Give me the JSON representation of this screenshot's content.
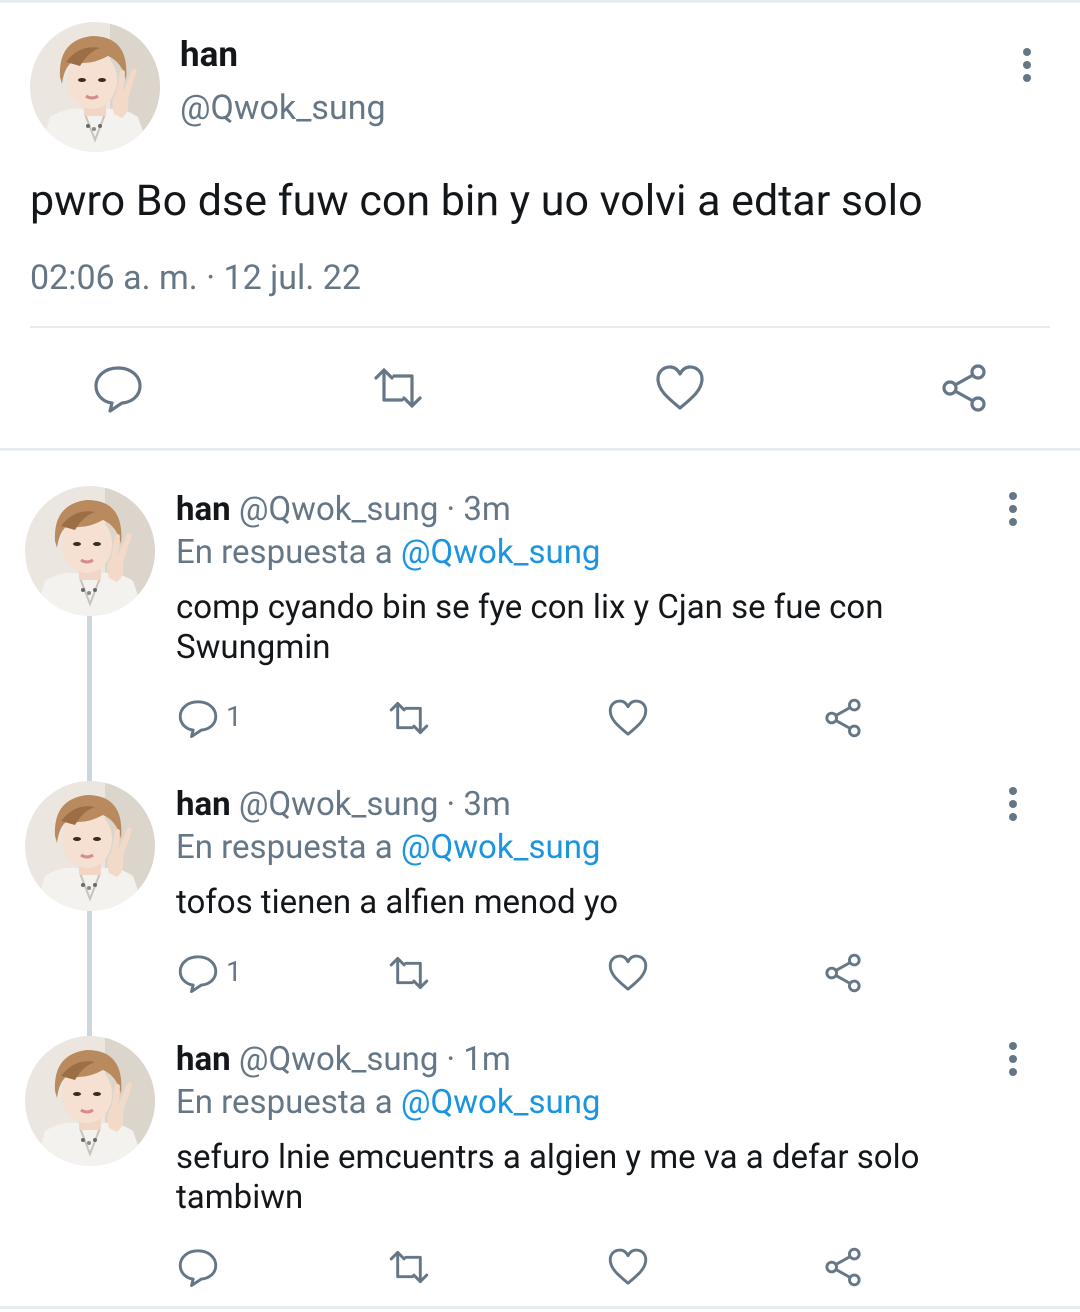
{
  "main_tweet": {
    "display_name": "han",
    "handle": "@Qwok_sung",
    "text": "pwro Bo dse fuw con bin y uo volvi a edtar solo",
    "timestamp": "02:06 a. m. · 12 jul. 22",
    "icons": [
      "reply-icon",
      "retweet-icon",
      "like-icon",
      "share-icon",
      "more-options-icon"
    ]
  },
  "replies": [
    {
      "display_name": "han",
      "handle_time": "@Qwok_sung · 3m",
      "in_reply_prefix": "En respuesta a",
      "in_reply_handle": "@Qwok_sung",
      "text": "comp cyando bin se fye con lix y Cjan se fue con Swungmin",
      "reply_count": "1"
    },
    {
      "display_name": "han",
      "handle_time": "@Qwok_sung · 3m",
      "in_reply_prefix": "En respuesta a",
      "in_reply_handle": "@Qwok_sung",
      "text": "tofos tienen a alfien menod yo",
      "reply_count": "1"
    },
    {
      "display_name": "han",
      "handle_time": "@Qwok_sung · 1m",
      "in_reply_prefix": "En respuesta a",
      "in_reply_handle": "@Qwok_sung",
      "text": "sefuro lnie emcuentrs a algien y me va a defar solo tambiwn",
      "reply_count": ""
    }
  ],
  "colors": {
    "text": "#14171a",
    "secondary": "#657786",
    "link": "#1b95e0",
    "divider": "#e6ecf0",
    "thread_line": "#ccd6dd"
  }
}
